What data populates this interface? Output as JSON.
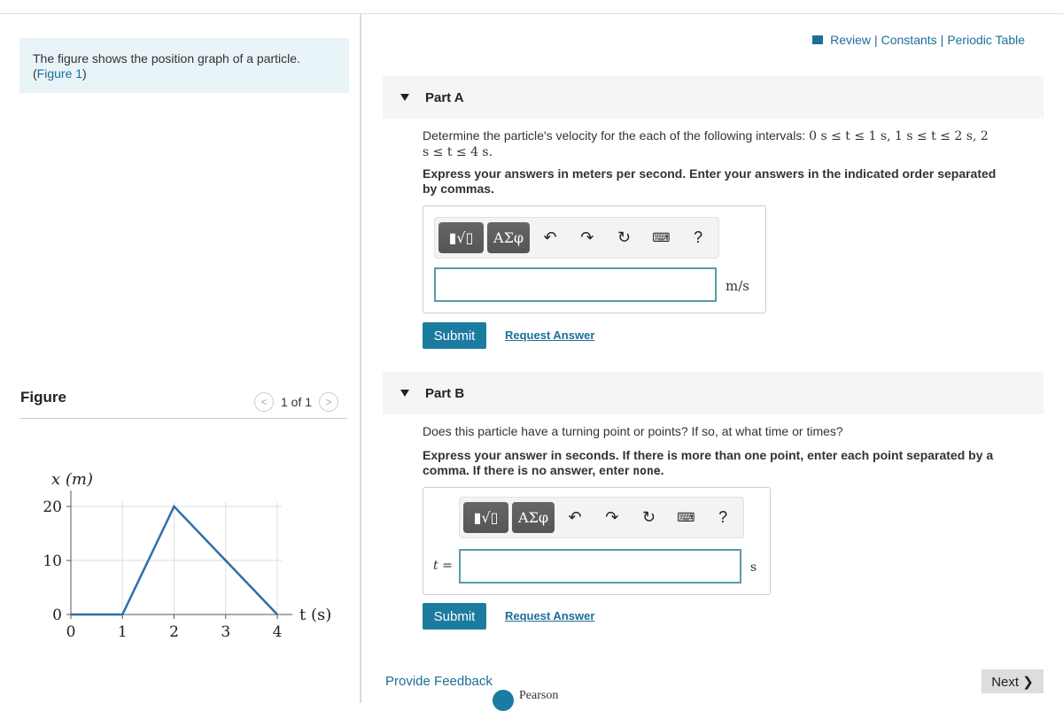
{
  "intro": {
    "text": "The figure shows the position graph of a particle.(",
    "link": "Figure 1",
    ")": ")"
  },
  "figure": {
    "label": "Figure",
    "pager": "1 of 1"
  },
  "top_links": [
    "Review",
    "Constants",
    "Periodic Table"
  ],
  "part_a": {
    "title": "Part A",
    "question": "Determine the particle's velocity for the each of the following intervals: ",
    "intervals": "0 s ≤ t ≤ 1 s, 1 s ≤ t ≤ 2 s, 2 s ≤ t ≤ 4 s.",
    "instructions": "Express your answers in meters per second. Enter your answers in the indicated order separated by commas.",
    "unit": "m/s",
    "answer_value": "",
    "submit": "Submit",
    "request": "Request Answer"
  },
  "part_b": {
    "title": "Part B",
    "question": "Does this particle have a turning point or points? If so, at what time or times?",
    "instructions": "Express your answer in seconds. If there is more than one point, enter each point separated by a comma. If there is no answer, enter ",
    "none": "none",
    "end": ".",
    "prefix": "t =",
    "unit": "s",
    "answer_value": "",
    "submit": "Submit",
    "request": "Request Answer"
  },
  "toolbar": {
    "templates": "▮√▯",
    "greek": "ΑΣφ",
    "undo": "undo-icon",
    "redo": "redo-icon",
    "reset": "reset-icon",
    "keyboard": "keyboard-icon",
    "help": "?"
  },
  "footer": {
    "feedback": "Provide Feedback",
    "next": "Next ❯",
    "brand": "Pearson"
  },
  "colors": {
    "accent": "#1c7ba0",
    "line": "#2f6ea8"
  },
  "chart_data": {
    "type": "line",
    "xlabel": "t (s)",
    "ylabel": "x (m)",
    "x": [
      0,
      1,
      2,
      4
    ],
    "y": [
      0,
      0,
      20,
      0
    ],
    "xlim": [
      0,
      4
    ],
    "ylim": [
      0,
      20
    ],
    "xticks": [
      "0",
      "1",
      "2",
      "3",
      "4"
    ],
    "yticks": [
      "0",
      "10",
      "20"
    ],
    "grid": true
  }
}
